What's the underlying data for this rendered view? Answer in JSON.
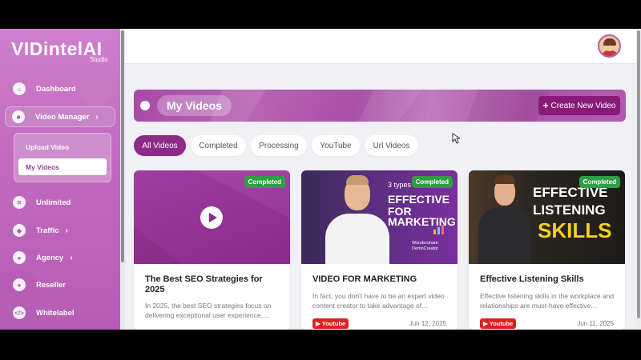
{
  "brand": {
    "name": "VIDintelAI",
    "sub": "Studio"
  },
  "sidebar": {
    "items": [
      {
        "label": "Dashboard",
        "icon": "home-icon"
      },
      {
        "label": "Video Manager",
        "icon": "video-icon"
      },
      {
        "label": "Unlimited",
        "icon": "x-circle-icon"
      },
      {
        "label": "Traffic",
        "icon": "shield-icon"
      },
      {
        "label": "Agency",
        "icon": "users-icon"
      },
      {
        "label": "Reseller",
        "icon": "user-icon"
      },
      {
        "label": "Whitelabel",
        "icon": "code-icon"
      }
    ],
    "submenu": [
      {
        "label": "Upload Video"
      },
      {
        "label": "My Videos"
      }
    ]
  },
  "header": {
    "title": "My Videos",
    "create_button": "Create New Video"
  },
  "tabs": [
    "All Videos",
    "Completed",
    "Processing",
    "YouTube",
    "Url Videos"
  ],
  "cards": [
    {
      "status": "Completed",
      "title": "The Best SEO Strategies for 2025",
      "desc": "In 2025, the best SEO strategies focus on delivering exceptional user experience,…",
      "source": "",
      "date": ""
    },
    {
      "status": "Completed",
      "title": "VIDEO FOR MARKETING",
      "thumb_text": {
        "top": "3 types",
        "main1": "EFFECTIVE",
        "main2": "FOR",
        "main3": "MARKETING",
        "brand": "Wondershare DemoCreator"
      },
      "desc": "In fact, you don't have to be an expert video content creator to take advantage of…",
      "source": "Youtube",
      "date": "Jun 12, 2025"
    },
    {
      "status": "Completed",
      "title": "Effective Listening Skills",
      "thumb_text": {
        "line1": "EFFECTIVE",
        "line2": "LISTENING",
        "line3": "SKILLS"
      },
      "desc": "Effective listening skills in the workplace and relationships are must-have effective…",
      "source": "Youtube",
      "date": "Jun 11, 2025"
    }
  ],
  "colors": {
    "accent": "#8e2a88",
    "sidebar": "#c26bbf",
    "badge": "#2f9e44",
    "youtube": "#e02020"
  }
}
